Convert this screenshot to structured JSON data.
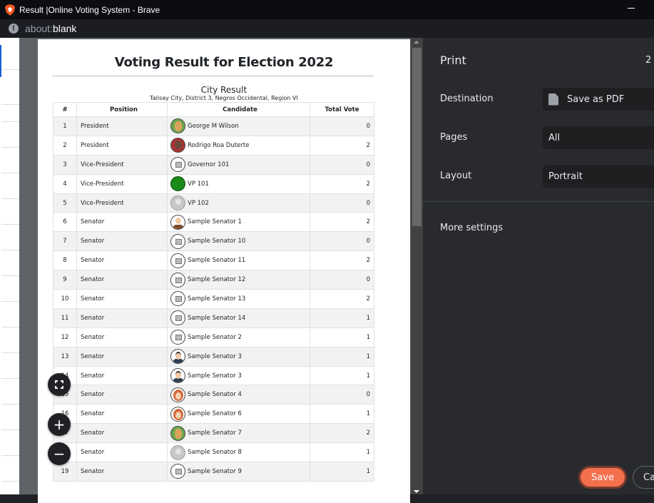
{
  "window": {
    "title": "Result |Online Voting System - Brave"
  },
  "address_bar": {
    "scheme": "about:",
    "host": "blank"
  },
  "document": {
    "title": "Voting Result for Election 2022",
    "subtitle": "City Result",
    "location": "Talisay City, District 3, Negros Occidental, Region VI",
    "table": {
      "headers": [
        "#",
        "Position",
        "Candidate",
        "Total Vote"
      ],
      "rows": [
        {
          "num": "1",
          "position": "President",
          "candidate": "George M Wilson",
          "votes": "0",
          "avatar": "cartoon-man-glasses"
        },
        {
          "num": "2",
          "position": "President",
          "candidate": "Rodrigo Roa Duterte",
          "votes": "2",
          "avatar": "photo"
        },
        {
          "num": "3",
          "position": "Vice-President",
          "candidate": "Governor 101",
          "votes": "0",
          "avatar": "placeholder"
        },
        {
          "num": "4",
          "position": "Vice-President",
          "candidate": "VP 101",
          "votes": "2",
          "avatar": "green"
        },
        {
          "num": "5",
          "position": "Vice-President",
          "candidate": "VP 102",
          "votes": "0",
          "avatar": "default-grey"
        },
        {
          "num": "6",
          "position": "Senator",
          "candidate": "Sample Senator 1",
          "votes": "2",
          "avatar": "cartoon-man"
        },
        {
          "num": "7",
          "position": "Senator",
          "candidate": "Sample Senator 10",
          "votes": "0",
          "avatar": "placeholder"
        },
        {
          "num": "8",
          "position": "Senator",
          "candidate": "Sample Senator 11",
          "votes": "2",
          "avatar": "placeholder"
        },
        {
          "num": "9",
          "position": "Senator",
          "candidate": "Sample Senator 12",
          "votes": "0",
          "avatar": "placeholder"
        },
        {
          "num": "10",
          "position": "Senator",
          "candidate": "Sample Senator 13",
          "votes": "2",
          "avatar": "placeholder"
        },
        {
          "num": "11",
          "position": "Senator",
          "candidate": "Sample Senator 14",
          "votes": "1",
          "avatar": "placeholder"
        },
        {
          "num": "12",
          "position": "Senator",
          "candidate": "Sample Senator 2",
          "votes": "1",
          "avatar": "placeholder"
        },
        {
          "num": "13",
          "position": "Senator",
          "candidate": "Sample Senator 3",
          "votes": "1",
          "avatar": "cartoon-suit"
        },
        {
          "num": "14",
          "position": "Senator",
          "candidate": "Sample Senator 3",
          "votes": "1",
          "avatar": "cartoon-suit"
        },
        {
          "num": "15",
          "position": "Senator",
          "candidate": "Sample Senator 4",
          "votes": "0",
          "avatar": "cartoon-woman-red"
        },
        {
          "num": "16",
          "position": "Senator",
          "candidate": "Sample Senator 6",
          "votes": "1",
          "avatar": "cartoon-woman-red"
        },
        {
          "num": "17",
          "position": "Senator",
          "candidate": "Sample Senator 7",
          "votes": "2",
          "avatar": "cartoon-man-glasses"
        },
        {
          "num": "18",
          "position": "Senator",
          "candidate": "Sample Senator 8",
          "votes": "1",
          "avatar": "default-grey"
        },
        {
          "num": "19",
          "position": "Senator",
          "candidate": "Sample Senator 9",
          "votes": "1",
          "avatar": "placeholder"
        }
      ]
    }
  },
  "preview_controls": {
    "fit_icon": "fit-to-page-icon",
    "zoom_in": "+",
    "zoom_out": "−"
  },
  "print_panel": {
    "title": "Print",
    "sheet_count": "2",
    "destination_label": "Destination",
    "destination_value": "Save as PDF",
    "pages_label": "Pages",
    "pages_value": "All",
    "layout_label": "Layout",
    "layout_value": "Portrait",
    "more_settings": "More settings",
    "save_button": "Save",
    "cancel_button": "Ca",
    "accent_color": "#f4704d"
  }
}
